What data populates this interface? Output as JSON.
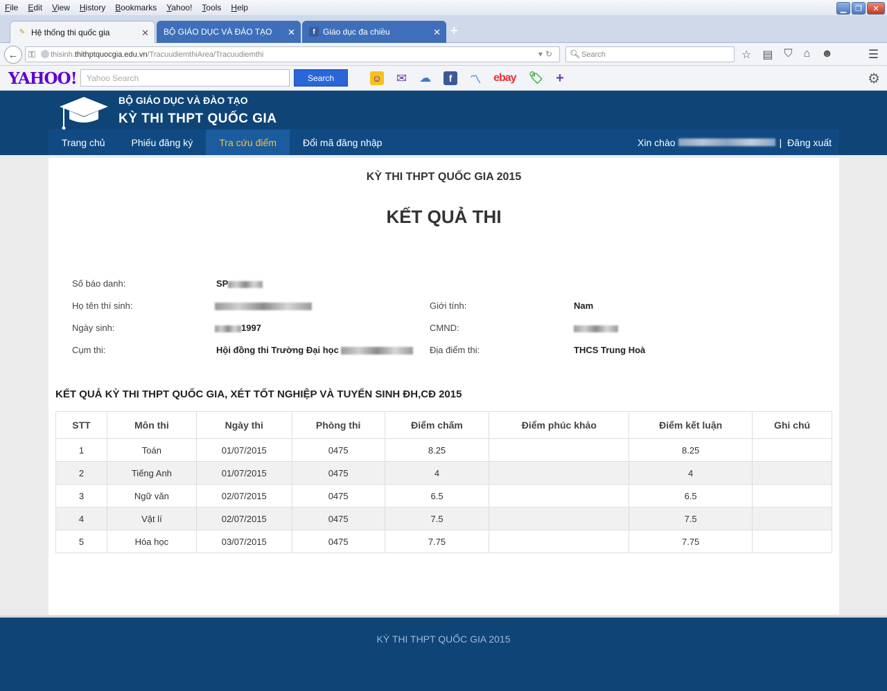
{
  "menu": [
    "File",
    "Edit",
    "View",
    "History",
    "Bookmarks",
    "Yahoo!",
    "Tools",
    "Help"
  ],
  "tabs": [
    {
      "label": "Hệ thống thi quốc gia"
    },
    {
      "label": "BỘ GIÁO DỤC VÀ ĐÀO TẠO"
    },
    {
      "label": "Giáo dục đa chiều"
    }
  ],
  "url": {
    "prefix": "thisinh.",
    "domain": "thithptquocgia.edu.vn",
    "path": "/TracuudiemthiArea/Tracuudiemthi"
  },
  "browser_search": {
    "placeholder": "Search"
  },
  "yahoo": {
    "logo": "YAHOO!",
    "placeholder": "Yahoo Search",
    "button": "Search",
    "ebay": "ebay"
  },
  "site": {
    "org": "BỘ GIÁO DỤC VÀ ĐÀO TẠO",
    "name": "KỲ THI THPT QUỐC GIA",
    "nav": [
      "Trang chủ",
      "Phiếu đăng ký",
      "Tra cứu điểm",
      "Đổi mã đăng nhập"
    ],
    "active_nav": "Tra cứu điểm",
    "greeting": "Xin chào",
    "separator": "|",
    "logout": "Đăng xuất"
  },
  "main": {
    "exam_title": "KỲ THI THPT QUỐC GIA 2015",
    "result_title": "KẾT QUẢ THI",
    "labels": {
      "sbd": "Số báo danh:",
      "name": "Họ tên thí sinh:",
      "gender": "Giới tính:",
      "dob": "Ngày sinh:",
      "id": "CMND:",
      "cluster": "Cụm thi:",
      "location": "Địa điểm thi:"
    },
    "values": {
      "sbd_prefix": "SP",
      "gender": "Nam",
      "dob_year": "1997",
      "cluster": "Hội đồng thi Trường Đại học",
      "location": "THCS Trung Hoà"
    },
    "section_title": "KẾT QUẢ KỲ THI THPT QUỐC GIA, XÉT TỐT NGHIỆP VÀ TUYỂN SINH ĐH,CĐ 2015",
    "table": {
      "headers": [
        "STT",
        "Môn thi",
        "Ngày thi",
        "Phòng thi",
        "Điểm chấm",
        "Điểm phúc khảo",
        "Điểm kết luận",
        "Ghi chú"
      ],
      "rows": [
        [
          "1",
          "Toán",
          "01/07/2015",
          "0475",
          "8.25",
          "",
          "8.25",
          ""
        ],
        [
          "2",
          "Tiếng Anh",
          "01/07/2015",
          "0475",
          "4",
          "",
          "4",
          ""
        ],
        [
          "3",
          "Ngữ văn",
          "02/07/2015",
          "0475",
          "6.5",
          "",
          "6.5",
          ""
        ],
        [
          "4",
          "Vật lí",
          "02/07/2015",
          "0475",
          "7.5",
          "",
          "7.5",
          ""
        ],
        [
          "5",
          "Hóa học",
          "03/07/2015",
          "0475",
          "7.75",
          "",
          "7.75",
          ""
        ]
      ]
    }
  },
  "footer": {
    "text": "KỲ THI THPT QUỐC GIA 2015"
  }
}
